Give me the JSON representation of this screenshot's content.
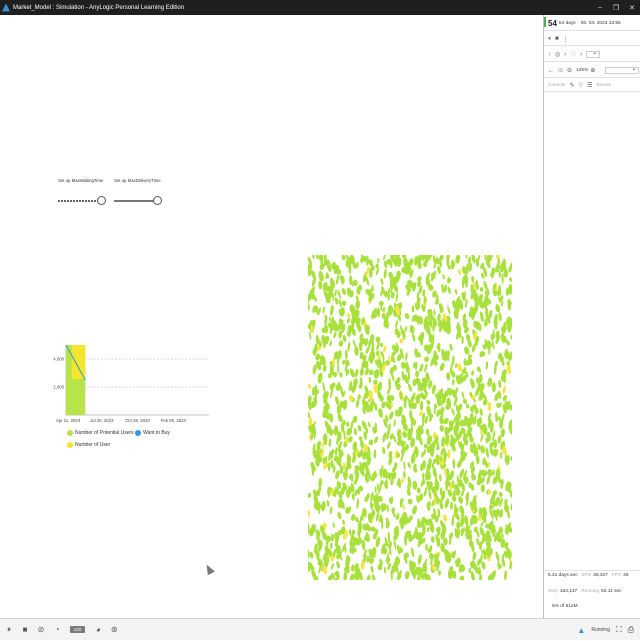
{
  "window": {
    "title": "Market_Model : Simulation - AnyLogic Personal Learning Edition",
    "controls": [
      "–",
      "❐",
      "✕"
    ]
  },
  "parameters": [
    {
      "label": "Set up MaxWaitingTime",
      "value_fraction": 1.0,
      "style": "dashed"
    },
    {
      "label": "Set up MaxDeliveryTime",
      "value_fraction": 1.0,
      "style": "solid"
    }
  ],
  "chart_data": {
    "type": "area",
    "x_ticks": [
      "Apr 11, 2023",
      "Jul 20, 2023",
      "Oct 28, 2023",
      "Feb 05, 2024"
    ],
    "y_ticks": [
      "2,000",
      "4,000"
    ],
    "ylim": [
      0,
      5000
    ],
    "x_days_range": [
      0,
      400
    ],
    "visible_days": 54,
    "series": [
      {
        "name": "Number of Potential Users",
        "color": "#b8e34a",
        "x": [
          0,
          54
        ],
        "values": [
          5000,
          5000
        ]
      },
      {
        "name": "Want to Buy",
        "color": "#2f9be0",
        "x": [
          0,
          54
        ],
        "values": [
          5000,
          2500
        ]
      },
      {
        "name": "Number of User",
        "color": "#f5e62a",
        "x": [
          0,
          54
        ],
        "values": [
          0,
          0
        ]
      }
    ],
    "grid": true,
    "legend": "bottom"
  },
  "agents_field": {
    "color_potential": "#a8e03c",
    "color_user": "#f2e64a"
  },
  "right_panel": {
    "time_big": "54",
    "time_suffix": "54 days",
    "date": "06. 04. 2023 13:56",
    "zoom": "125%",
    "console_tab": "Console",
    "events_tab": "Events",
    "stats": {
      "days_per_sec_label": "5.21 days sec",
      "eps_label": "EPS",
      "eps_value": "28,327",
      "fps_label": "FPS",
      "fps_value": "26",
      "step_label": "Step",
      "step_value": "164,137",
      "running_label": "Running",
      "running_value": "53.11 sec",
      "memory": "5% of 512M"
    }
  },
  "bottombar": {
    "speed": "x20",
    "status": "Running"
  }
}
